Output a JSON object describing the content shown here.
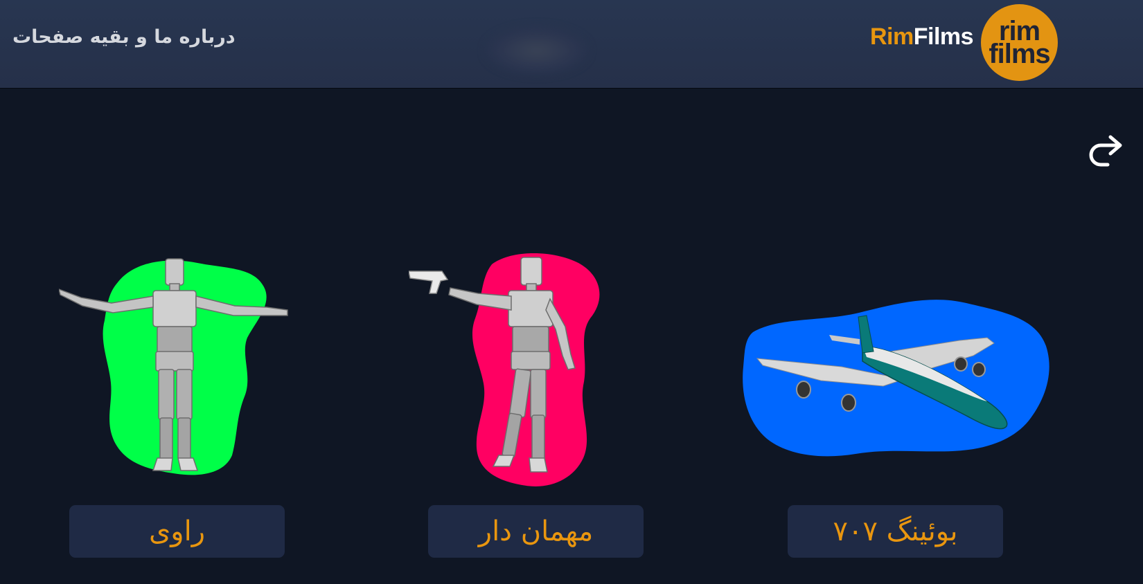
{
  "header": {
    "about_link": "درباره ما و بقیه صفحات",
    "brand_rim": "Rim",
    "brand_films": "Films",
    "logo_line1": "rim",
    "logo_line2": "films"
  },
  "cards": [
    {
      "label": "راوی",
      "icon": "tpose-mannequin-figure",
      "blob_color": "#00ff48"
    },
    {
      "label": "مهمان دار",
      "icon": "mannequin-with-pistol",
      "blob_color": "#ff0062"
    },
    {
      "label": "بوئینگ ۷۰۷",
      "icon": "boeing-707-airplane",
      "blob_color": "#0067ff"
    }
  ],
  "colors": {
    "background": "#0f1624",
    "header": "#273450",
    "accent": "#e8960f",
    "card_label_bg": "#1f2a45"
  }
}
